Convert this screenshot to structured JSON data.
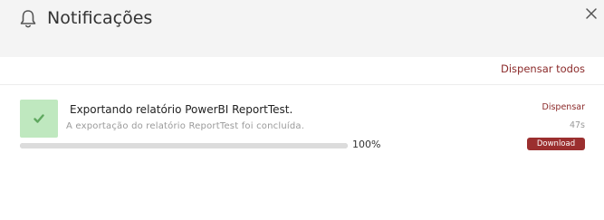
{
  "header": {
    "title": "Notificações",
    "bell_icon": "bell-icon",
    "close_icon": "close-icon"
  },
  "actions": {
    "dismiss_all_label": "Dispensar todos"
  },
  "notifications": [
    {
      "title": "Exportando relatório PowerBI ReportTest.",
      "description": "A exportação do relatório ReportTest foi concluída.",
      "status_icon": "check-icon",
      "progress_percent": 100,
      "progress_label": "100%",
      "dismiss_label": "Dispensar",
      "time": "47s",
      "download_label": "Download"
    }
  ],
  "colors": {
    "accent": "#9b2f2f",
    "link": "#8b2a2a",
    "success_bg": "#bfe8bf",
    "success_icon": "#5fa85f",
    "header_bg": "#f4f4f4"
  }
}
